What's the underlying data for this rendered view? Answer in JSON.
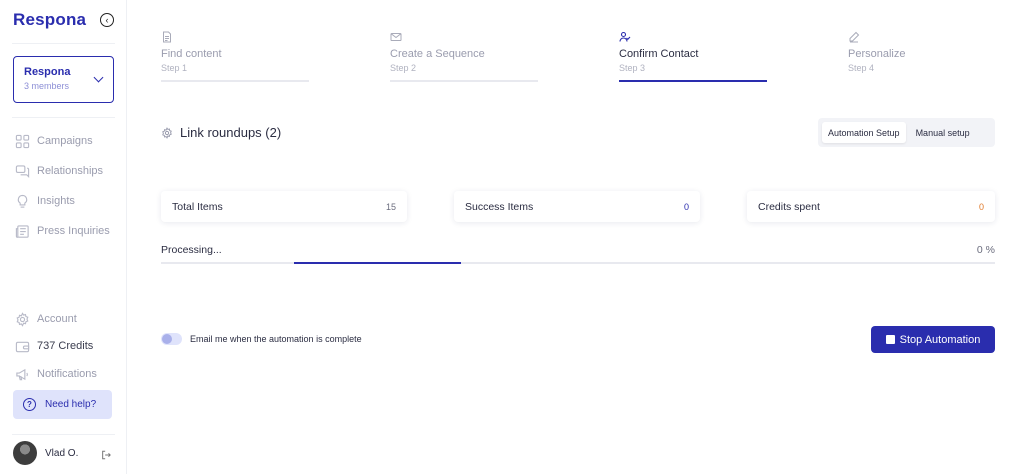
{
  "brand": {
    "logo_text": "Respona",
    "accent": "#2a2dae"
  },
  "workspace": {
    "name": "Respona",
    "members": "3 members"
  },
  "nav": {
    "items": [
      {
        "label": "Campaigns",
        "icon": "grid-icon"
      },
      {
        "label": "Relationships",
        "icon": "chat-icon"
      },
      {
        "label": "Insights",
        "icon": "lightbulb-icon"
      },
      {
        "label": "Press Inquiries",
        "icon": "newspaper-icon"
      }
    ],
    "bottom": [
      {
        "label": "Account",
        "icon": "gear-icon"
      },
      {
        "label": "737 Credits",
        "icon": "wallet-icon"
      },
      {
        "label": "Notifications",
        "icon": "megaphone-icon"
      }
    ],
    "help_label": "Need help?"
  },
  "user": {
    "name": "Vlad O."
  },
  "steps": [
    {
      "title": "Find content",
      "sub": "Step 1",
      "icon": "document-icon",
      "active": false
    },
    {
      "title": "Create a Sequence",
      "sub": "Step 2",
      "icon": "envelope-icon",
      "active": false
    },
    {
      "title": "Confirm Contact",
      "sub": "Step 3",
      "icon": "user-check-icon",
      "active": true
    },
    {
      "title": "Personalize",
      "sub": "Step 4",
      "icon": "pen-icon",
      "active": false
    }
  ],
  "section": {
    "title": "Link roundups (2)"
  },
  "setup_toggle": {
    "automation": "Automation Setup",
    "manual": "Manual setup",
    "selected": "automation"
  },
  "stats": [
    {
      "label": "Total Items",
      "value": "15",
      "color": "#6b6d7e"
    },
    {
      "label": "Success Items",
      "value": "0",
      "color": "#2a2dae"
    },
    {
      "label": "Credits spent",
      "value": "0",
      "color": "#e07a2b"
    }
  ],
  "progress": {
    "label": "Processing...",
    "percent_text": "0 %"
  },
  "email_toggle": {
    "label": "Email me when the automation is complete",
    "on": false
  },
  "stop_button": {
    "label": "Stop Automation"
  }
}
